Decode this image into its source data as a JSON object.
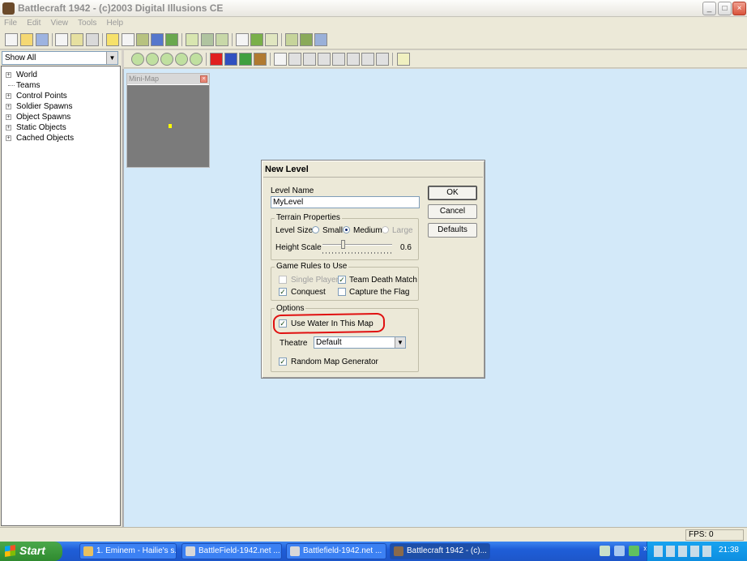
{
  "window": {
    "title": "Battlecraft 1942 - (c)2003 Digital Illusions CE",
    "minimize": "_",
    "maximize": "□",
    "close": "×"
  },
  "menu": [
    "File",
    "Edit",
    "View",
    "Tools",
    "Help"
  ],
  "left_panel": {
    "filter_value": "Show All",
    "tree": [
      {
        "label": "World",
        "expander": "+"
      },
      {
        "label": "Teams",
        "expander": ""
      },
      {
        "label": "Control Points",
        "expander": "+"
      },
      {
        "label": "Soldier Spawns",
        "expander": "+"
      },
      {
        "label": "Object Spawns",
        "expander": "+"
      },
      {
        "label": "Static Objects",
        "expander": "+"
      },
      {
        "label": "Cached Objects",
        "expander": "+"
      }
    ]
  },
  "minimap": {
    "title": "Mini-Map",
    "close": "×"
  },
  "dialog": {
    "title": "New Level",
    "level_name_label": "Level Name",
    "level_name_value": "MyLevel",
    "buttons": {
      "ok": "OK",
      "cancel": "Cancel",
      "defaults": "Defaults"
    },
    "terrain": {
      "group_label": "Terrain Properties",
      "level_size_label": "Level Size",
      "sizes": [
        "Small",
        "Medium",
        "Large"
      ],
      "selected_size": "Medium",
      "height_scale_label": "Height Scale",
      "height_scale_value": "0.6"
    },
    "game_rules": {
      "group_label": "Game Rules to Use",
      "single_player": "Single Player",
      "team_death_match": "Team Death Match",
      "conquest": "Conquest",
      "capture_the_flag": "Capture the Flag",
      "checked": [
        "Team Death Match",
        "Conquest"
      ]
    },
    "options": {
      "group_label": "Options",
      "use_water": "Use Water In This Map",
      "theatre_label": "Theatre",
      "theatre_value": "Default",
      "random_map_generator": "Random Map Generator"
    },
    "checkmark": "✓",
    "dropdown_arrow": "▼",
    "highlight_color": "#e01010"
  },
  "statusbar": {
    "fps": "FPS: 0"
  },
  "taskbar": {
    "start": "Start",
    "tasks": [
      "1. Eminem - Hailie's s...",
      "BattleField-1942.net ...",
      "Battlefield-1942.net ...",
      "Battlecraft 1942 - (c)..."
    ],
    "clock": "21:38",
    "expand": "»"
  }
}
